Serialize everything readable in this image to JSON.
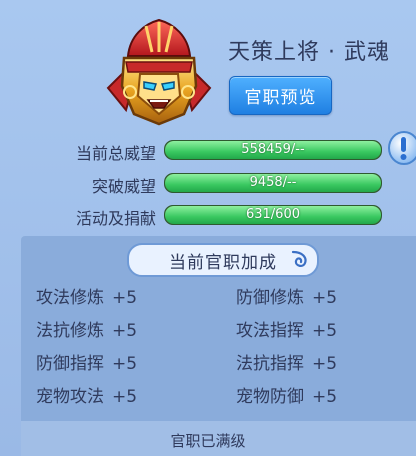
{
  "rank": {
    "title": "天策上将 · 武魂",
    "preview_label": "官职预览"
  },
  "stats": [
    {
      "label": "当前总威望",
      "value_text": "558459/--",
      "fill": 1.0
    },
    {
      "label": "突破威望",
      "value_text": "9458/--",
      "fill": 1.0
    },
    {
      "label": "活动及捐献",
      "value_text": "631/600",
      "fill": 1.0
    }
  ],
  "bonus": {
    "header": "当前官职加成",
    "items": [
      {
        "name": "攻法修炼",
        "value": "+5"
      },
      {
        "name": "防御修炼",
        "value": "+5"
      },
      {
        "name": "法抗修炼",
        "value": "+5"
      },
      {
        "name": "攻法指挥",
        "value": "+5"
      },
      {
        "name": "防御指挥",
        "value": "+5"
      },
      {
        "name": "法抗指挥",
        "value": "+5"
      },
      {
        "name": "宠物攻法",
        "value": "+5"
      },
      {
        "name": "宠物防御",
        "value": "+5"
      }
    ]
  },
  "footer": {
    "status": "官职已满级"
  },
  "colors": {
    "bar_fill": "#39c860",
    "button_blue": "#1f7fe2",
    "text_dark": "#2f3a5c",
    "panel_bg": "#a9c8f0"
  },
  "icons": {
    "emblem": "golden-helmet-icon",
    "info": "exclamation-icon",
    "swirl": "cloud-swirl-icon"
  }
}
